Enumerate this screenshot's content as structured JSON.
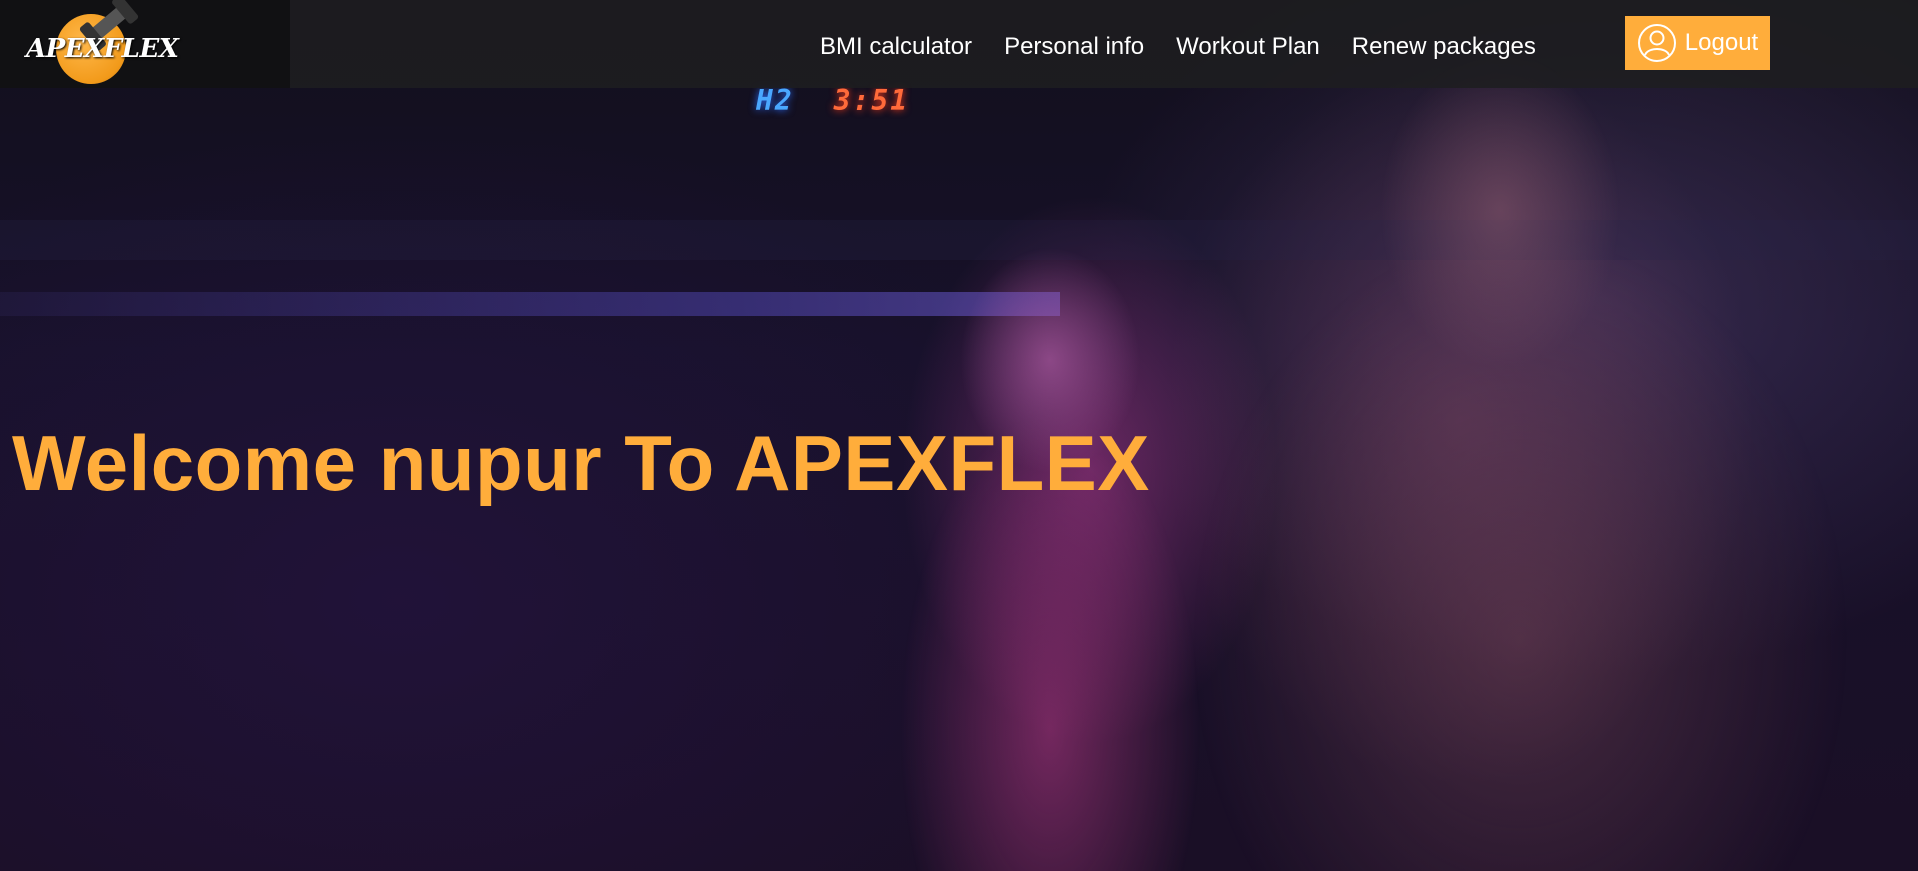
{
  "brand": {
    "logo_text": "APEXFLEX",
    "accent_color": "#ffad3b"
  },
  "nav": {
    "items": [
      {
        "label": "BMI calculator"
      },
      {
        "label": "Personal info"
      },
      {
        "label": "Workout Plan"
      },
      {
        "label": "Renew packages"
      }
    ],
    "logout": {
      "label": "Logout",
      "icon": "user-circle-icon"
    }
  },
  "hero": {
    "welcome_text": "Welcome nupur To APEXFLEX",
    "scoreboard": {
      "left": "H2",
      "right": "3:51"
    }
  }
}
